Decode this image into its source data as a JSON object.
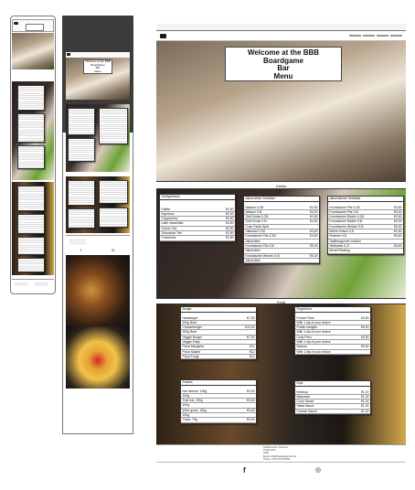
{
  "welcome": {
    "line1": "Welcome at the BBB",
    "line2": "Boardgame",
    "line3": "Bar",
    "line4": "Menu"
  },
  "tablet_welcome": {
    "line1": "Welcome at the BBB",
    "line2": "Boardgame",
    "line3": "Bar",
    "line4": "Menu"
  },
  "sections": {
    "drinks": "Drinks",
    "food": "Food"
  },
  "hot_drinks": {
    "title": "Heißgetränke",
    "rows": [
      [
        "Kaffee",
        "€2,50"
      ],
      [
        "Espresso",
        "€2,00"
      ],
      [
        "Cappuccino",
        "€2,50"
      ],
      [
        "Latte macchiato",
        "€4,50"
      ],
      [
        "Grüner Tee",
        "€2,50"
      ],
      [
        "Schwarzer Tee",
        "€2,50"
      ],
      [
        "Früchtetee",
        "€2,50"
      ]
    ]
  },
  "soft_drinks": {
    "title": "Alkoholfreie Getränke",
    "rows": [
      [
        "Wasser 0,33l",
        "€2,50"
      ],
      [
        "Wasser 0,5l",
        "€3,00"
      ],
      [
        "Soft Drinks 0,33l",
        "€2,50"
      ],
      [
        "Soft Drinks 0,5l",
        "€4,50"
      ],
      [
        "Cola, Fanta Sprit",
        "",
        ""
      ],
      [
        "Vitamalz 0,33l",
        "€3,50"
      ],
      [
        "Krombacher Pils 0,33l",
        "€3,50"
      ],
      [
        "Alkoholfrei",
        ""
      ],
      [
        "Krombacher Pils 0,5l",
        "€5,00"
      ],
      [
        "Alkoholfrei",
        ""
      ],
      [
        "Krombacher Weizen 0,5l",
        "€5,00"
      ],
      [
        "Alkoholfrei",
        ""
      ]
    ]
  },
  "alcohol": {
    "title": "Alkoholische Getränke",
    "rows": [
      [
        "Krombacher Pils 0,33l",
        "€3,50"
      ],
      [
        "Krombacher Pils 0,5l",
        "€5,00"
      ],
      [
        "Krombacher Radler 0,33l",
        "€3,50"
      ],
      [
        "Krombacher Radler 0,5l",
        "€5,00"
      ],
      [
        "Krombacher Weizen 0,5l",
        "€5,00"
      ],
      [
        "Mühle Kölsch 0,2l",
        "€2,50"
      ],
      [
        "Rotwein 0,2l",
        "€5,50"
      ],
      [
        "Spätburgunder trocken",
        ""
      ],
      [
        "Weißwein 0,2l",
        "€5,50"
      ],
      [
        "Mosel Riesling",
        ""
      ]
    ]
  },
  "burger": {
    "title": "Burger",
    "rows": [
      [
        "Hamburger",
        "€7,50"
      ],
      [
        "200g Beef",
        ""
      ],
      [
        "Cheeseburger",
        "€10,00"
      ],
      [
        "200g Beef",
        ""
      ],
      [
        "Veggie Burger",
        "€7,50"
      ],
      [
        "Veggie-Patty",
        ""
      ],
      [
        "Pizza Margarita",
        "€11"
      ],
      [
        "Pizza Salami",
        "€12"
      ],
      [
        "Pizza Fungi",
        "€12"
      ]
    ]
  },
  "fingerfood": {
    "title": "Fingerfood",
    "rows": [
      [
        "French Fries",
        "€4,50"
      ],
      [
        "With 1 dip of your choice",
        ""
      ],
      [
        "Potato wedges",
        "€5,00"
      ],
      [
        "With 1 dip of your choice",
        ""
      ],
      [
        "Curly Fries",
        "€5,50"
      ],
      [
        "With 1 dip of your choice",
        ""
      ],
      [
        "Nachos",
        "€5,50"
      ],
      [
        "With 1 dip of your choice",
        ""
      ]
    ]
  },
  "snacks": {
    "title": "Snacks",
    "rows": [
      [
        "Nut mixture, 150g",
        "€3,00"
      ],
      [
        "100g",
        ""
      ],
      [
        "Trail mix, 150g",
        "€3,00"
      ],
      [
        "100g",
        ""
      ],
      [
        "Wine gums, 150g",
        "€3,00"
      ],
      [
        "100g",
        ""
      ],
      [
        "Chips, 75g",
        "€3,00"
      ]
    ]
  },
  "dips": {
    "title": "Dips",
    "rows": [
      [
        "Ketchup",
        "€1,00"
      ],
      [
        "Majonese",
        "€1,00"
      ],
      [
        "Curry Sauce",
        "€1,00"
      ],
      [
        "Salsa Sauce",
        "€1,00"
      ],
      [
        "Cheese Sauce",
        "€1,00"
      ]
    ]
  },
  "footer": {
    "address": "Straßenname, Nummer\nPostleitzahl\nStadt",
    "contact": "Email: info@boardgame-bar.de\nPhone: +49 1234 567890"
  },
  "icons": {
    "facebook": "f",
    "instagram": "◎"
  }
}
